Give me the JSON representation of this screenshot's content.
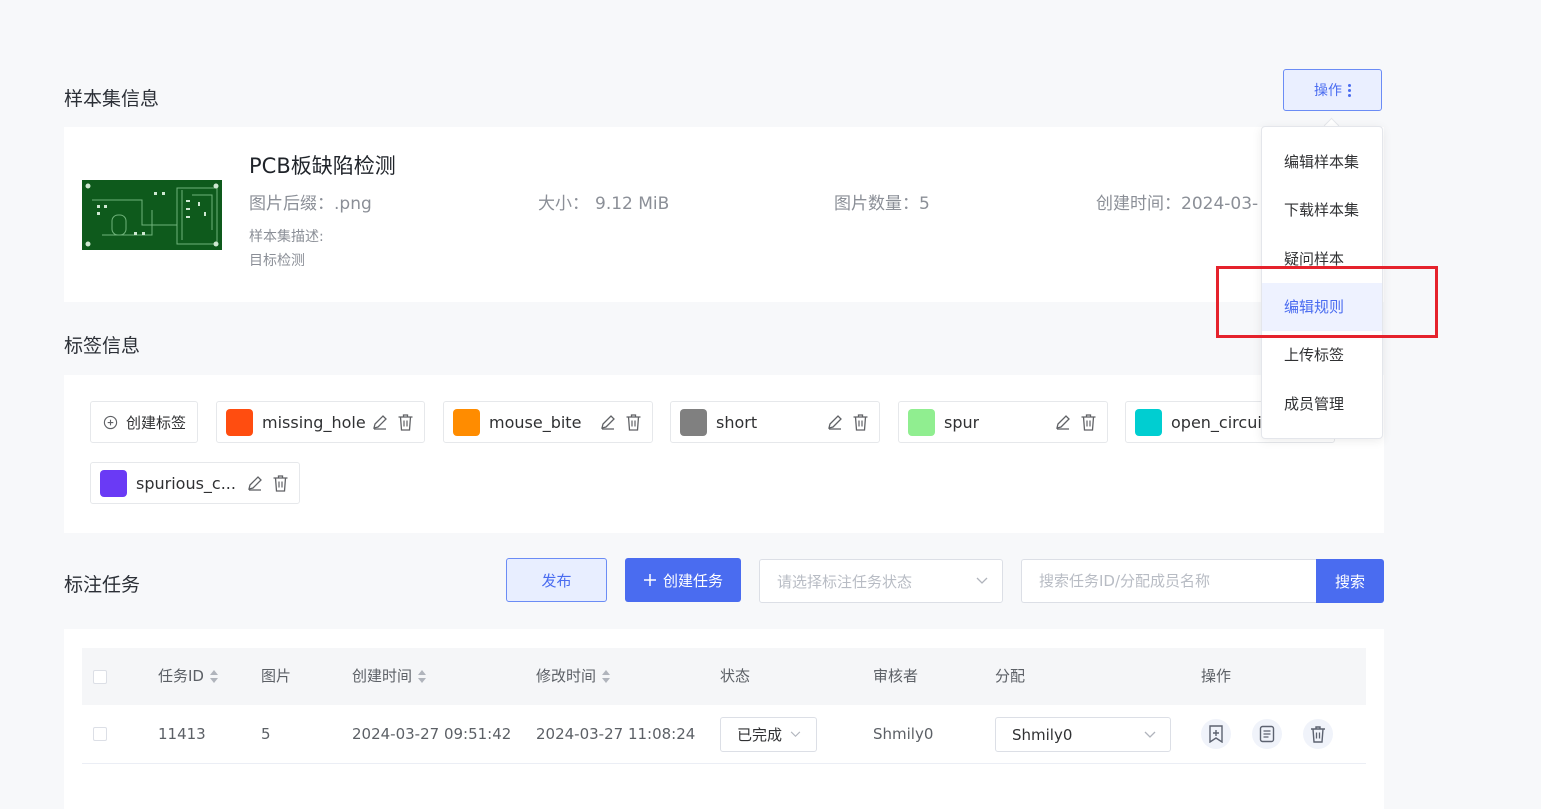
{
  "dataset_section": {
    "title": "样本集信息",
    "ops_label": "操作",
    "name": "PCB板缺陷检测",
    "suffix_label": "图片后缀：",
    "suffix_value": ".png",
    "size_label": "大小：",
    "size_value": "9.12 MiB",
    "count_label": "图片数量：",
    "count_value": "5",
    "created_label": "创建时间：",
    "created_value": "2024-03-",
    "desc_label": "样本集描述:",
    "desc_value": "目标检测"
  },
  "ops_menu": {
    "items": [
      {
        "label": "编辑样本集"
      },
      {
        "label": "下载样本集"
      },
      {
        "label": "疑问样本"
      },
      {
        "label": "编辑规则"
      },
      {
        "label": "上传标签"
      },
      {
        "label": "成员管理"
      }
    ],
    "active_index": 3
  },
  "tags_section": {
    "title": "标签信息",
    "create_label": "创建标签",
    "tags": [
      {
        "label": "missing_hole",
        "color": "#ff4d10"
      },
      {
        "label": "mouse_bite",
        "color": "#ff8c00"
      },
      {
        "label": "short",
        "color": "#808080"
      },
      {
        "label": "spur",
        "color": "#90ee90"
      },
      {
        "label": "open_circuit",
        "color": "#00ced1"
      },
      {
        "label": "spurious_c...",
        "color": "#6a3af5"
      }
    ]
  },
  "tasks_section": {
    "title": "标注任务",
    "publish_label": "发布",
    "create_task_label": "创建任务",
    "status_placeholder": "请选择标注任务状态",
    "search_placeholder": "搜索任务ID/分配成员名称",
    "search_label": "搜索",
    "columns": {
      "task_id": "任务ID",
      "images": "图片",
      "created": "创建时间",
      "modified": "修改时间",
      "status": "状态",
      "reviewer": "审核者",
      "assign": "分配",
      "ops": "操作"
    },
    "rows": [
      {
        "task_id": "11413",
        "images": "5",
        "created": "2024-03-27 09:51:42",
        "modified": "2024-03-27 11:08:24",
        "status": "已完成",
        "reviewer": "Shmily0",
        "assign": "Shmily0"
      }
    ]
  }
}
